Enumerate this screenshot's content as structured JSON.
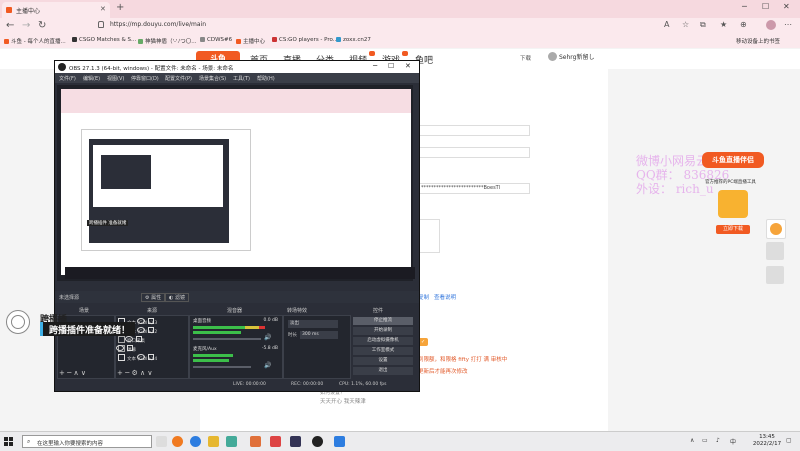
{
  "browser": {
    "tab_title": "主播中心",
    "url": "https://mp.douyu.com/live/main",
    "bookmarks": [
      "斗鱼 - 每个人的直播...",
      "CSGO Matches & S...",
      "神猫神盾（'-'ﾉつ〇...",
      "CDWS#6",
      "主播中心",
      "CS:GO players - Pro...",
      "zoxx.cn27"
    ],
    "reading_list": "移动设备上的书签"
  },
  "douyu": {
    "logo": "斗鱼",
    "nav": [
      "首页",
      "直播",
      "分类",
      "视频",
      "游戏",
      "鱼吧"
    ],
    "download": "下载",
    "username": "Sehrg新留し"
  },
  "watermark": {
    "line1": "微博小网易云",
    "line2": "QQ群：  836826",
    "line3": "外设：   rich_u"
  },
  "promo": {
    "title": "斗鱼直播伴侣",
    "subtitle": "官方推荐的PC端直播工具",
    "button": "立即下载"
  },
  "content": {
    "stream_key_fragment": "*************************BoesTl",
    "link1": "复制",
    "link2": "查看说明",
    "notice": "到限额，和限格 fifty 打打 满   审核中",
    "notice2": "更新后才能再次修改",
    "bottom_text": "天天开心 我天辣津",
    "bottom_small": "如何设置？"
  },
  "obs": {
    "title": "OBS 27.1.3 (64-bit, windows) - 配置文件: 未命名 - 场景: 未命名",
    "menu": [
      "文件(F)",
      "编辑(E)",
      "视图(V)",
      "停靠窗口(D)",
      "配置文件(P)",
      "场景集合(S)",
      "工具(T)",
      "帮助(H)"
    ],
    "no_source": "未选择源",
    "props_btn": "属性",
    "filters_btn": "滤镜",
    "docks": [
      "场景",
      "来源",
      "混音器",
      "转场特效",
      "控件"
    ],
    "sources": [
      "文本 (GDI+) 3",
      "文本 (GDI+) 2",
      "窗口采集",
      "弹幕",
      "文本 (GDI+) 4"
    ],
    "mixer": [
      {
        "name": "桌面音频",
        "db": "0.0 dB"
      },
      {
        "name": "麦克风/Aux",
        "db": "-5.8 dB"
      }
    ],
    "transition": "淡出",
    "duration_label": "时长",
    "duration": "300 ms",
    "controls": [
      "停止推流",
      "开始录制",
      "启动虚拟摄像机",
      "工作室模式",
      "设置",
      "退出"
    ],
    "status": {
      "live": "LIVE: 00:00:00",
      "rec": "REC: 00:00:00",
      "cpu": "CPU: 1.1%, 60.00 fps"
    },
    "preview_label": "跨播插件 准备就绪"
  },
  "widget": {
    "top_text": "跨播插",
    "bar_text": "跨播插件准备就绪！"
  },
  "taskbar": {
    "search": "在这里输入你要搜索的内容",
    "time": "13:45",
    "date": "2022/2/17"
  }
}
